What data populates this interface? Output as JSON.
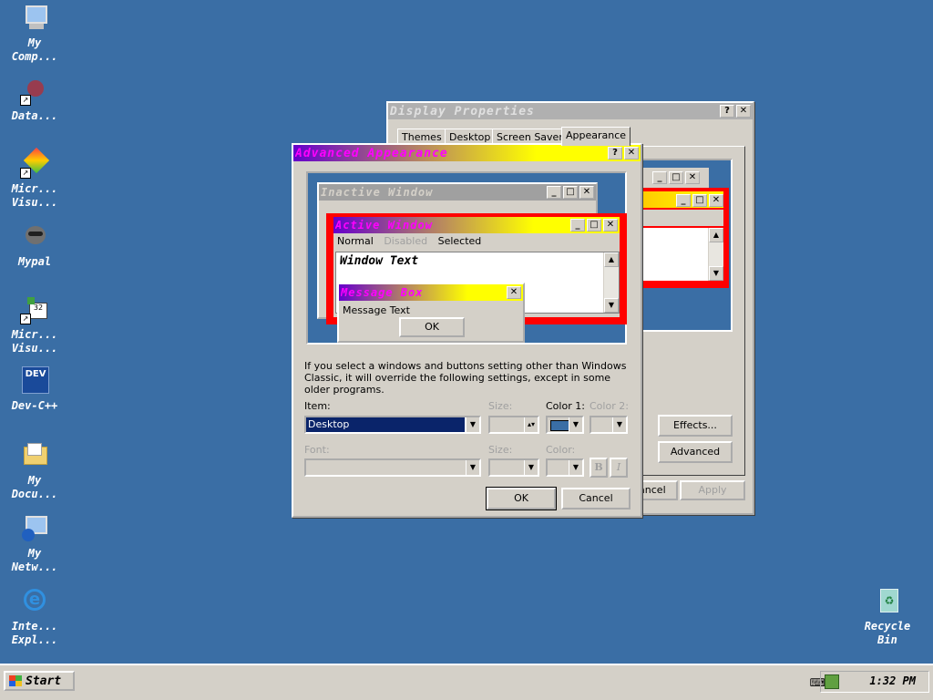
{
  "desktop": {
    "icons": [
      {
        "label": "My\nComp..."
      },
      {
        "label": "Data..."
      },
      {
        "label": "Micr...\nVisu..."
      },
      {
        "label": "Mypal"
      },
      {
        "label": "Micr...\nVisu..."
      },
      {
        "label": "Dev-C++"
      },
      {
        "label": "My\nDocu..."
      },
      {
        "label": "My\nNetw..."
      },
      {
        "label": "Inte...\nExpl..."
      },
      {
        "label": "Recycle\nBin"
      }
    ]
  },
  "display_properties": {
    "title": "Display Properties",
    "help": "?",
    "close": "✕",
    "tabs": [
      "Themes",
      "Desktop",
      "Screen Saver",
      "Appearance"
    ],
    "buttons": {
      "effects": "Effects...",
      "advanced": "Advanced",
      "cancel": "Cancel",
      "apply": "Apply"
    }
  },
  "advanced": {
    "title": "Advanced Appearance",
    "help": "?",
    "close": "✕",
    "preview": {
      "inactive_title": "Inactive Window",
      "active_title": "Active Window",
      "menu": [
        "Normal",
        "Disabled",
        "Selected"
      ],
      "window_text": "Window Text",
      "msgbox_title": "Message Box",
      "msgbox_text": "Message Text",
      "msgbox_ok": "OK"
    },
    "info": "If you select a windows and buttons setting other than Windows Classic, it will override the following settings, except in some older programs.",
    "labels": {
      "item": "Item:",
      "size": "Size:",
      "color1": "Color 1:",
      "color2": "Color 2:",
      "font": "Font:",
      "size2": "Size:",
      "color": "Color:"
    },
    "item_value": "Desktop",
    "color1_value": "#3a6ea5",
    "bold": "B",
    "italic": "I",
    "ok": "OK",
    "cancel": "Cancel"
  },
  "taskbar": {
    "start": "Start",
    "clock": "1:32 PM"
  },
  "colors": {
    "desktop": "#3a6ea5",
    "active_title_from": "#6600cc",
    "active_title_to": "#ffff00",
    "active_text": "#ff00ff",
    "inactive_title": "#a0a0a0",
    "border_red": "#ff0000",
    "selection": "#0a246a"
  }
}
